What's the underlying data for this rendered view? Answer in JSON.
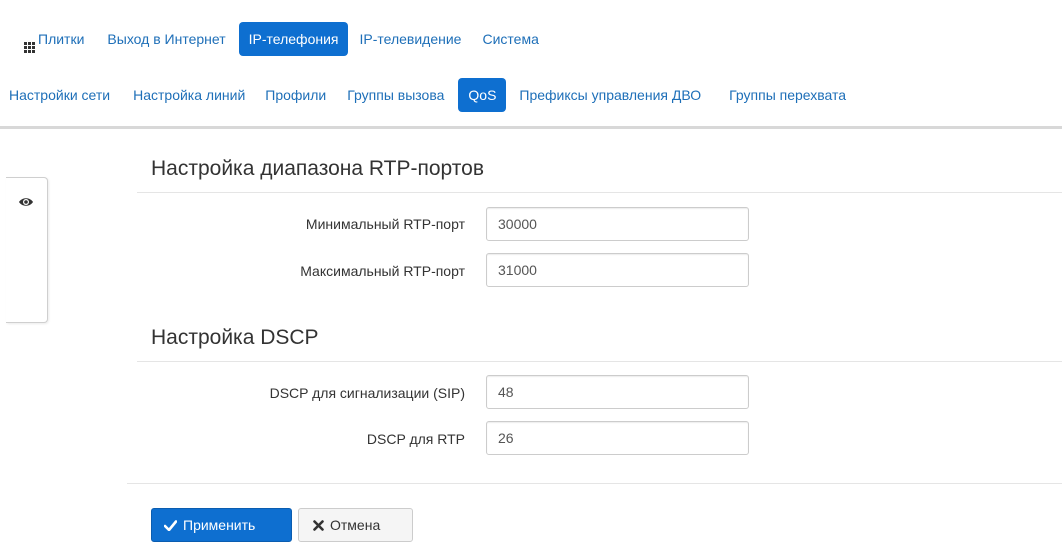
{
  "top_nav": [
    {
      "label": "Плитки",
      "icon": "grid-icon",
      "active": false
    },
    {
      "label": "Выход в Интернет",
      "active": false
    },
    {
      "label": "IP-телефония",
      "active": true
    },
    {
      "label": "IP-телевидение",
      "active": false
    },
    {
      "label": "Система",
      "active": false
    }
  ],
  "sub_nav": [
    {
      "label": "Настройки сети",
      "active": false
    },
    {
      "label": "Настройка линий",
      "active": false
    },
    {
      "label": "Профили",
      "active": false
    },
    {
      "label": "Группы вызова",
      "active": false
    },
    {
      "label": "QoS",
      "active": true
    },
    {
      "label": "Префиксы управления ДВО",
      "active": false
    },
    {
      "label": "Группы перехвата",
      "active": false
    }
  ],
  "side_panel": {
    "icon": "eye-icon"
  },
  "rtp_section": {
    "title": "Настройка диапазона RTP-портов",
    "min_label": "Минимальный RTP-порт",
    "min_value": "30000",
    "max_label": "Максимальный RTP-порт",
    "max_value": "31000"
  },
  "dscp_section": {
    "title": "Настройка DSCP",
    "sip_label": "DSCP для сигнализации (SIP)",
    "sip_value": "48",
    "rtp_label": "DSCP для RTP",
    "rtp_value": "26"
  },
  "actions": {
    "apply_label": "Применить",
    "cancel_label": "Отмена"
  },
  "colors": {
    "accent": "#0e6fd0",
    "link": "#1e6fb8"
  }
}
